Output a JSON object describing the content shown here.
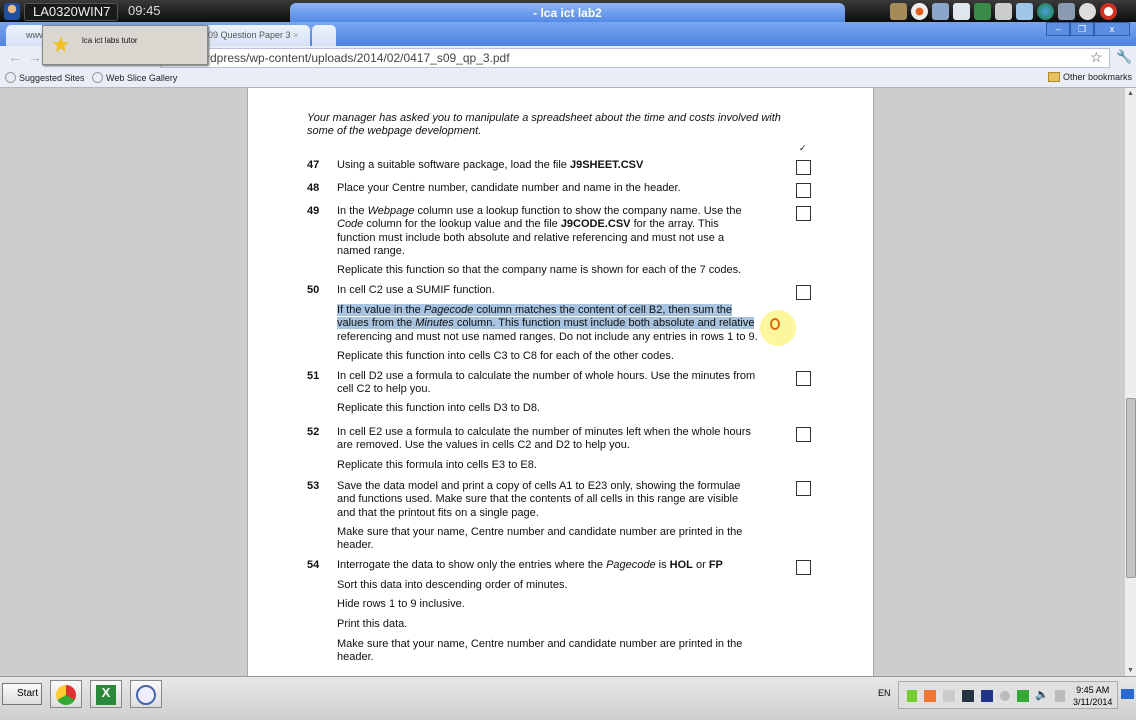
{
  "topbar": {
    "host": "LA0320WIN7",
    "clock": "09:45",
    "window_title": "- lca ict lab2"
  },
  "tabs": [
    {
      "label": "www"
    },
    {
      "label": "09 Question Paper 3"
    }
  ],
  "tooltip": {
    "label": "lca ict labs tutor"
  },
  "window_controls": {
    "minimize": "–",
    "restore": "❐",
    "close": "x"
  },
  "address": {
    "url": "rdpress/wp-content/uploads/2014/02/0417_s09_qp_3.pdf"
  },
  "bookmarks": {
    "items": [
      "Suggested Sites",
      "Web Slice Gallery"
    ],
    "other": "Other bookmarks"
  },
  "doc": {
    "checkmark": "✓",
    "intro": [
      [
        {
          "t": "Your manager has asked you to manipulate a spreadsheet about the time and costs involved with",
          "i": 1
        }
      ],
      [
        {
          "t": "some of the webpage development.",
          "i": 1
        }
      ]
    ],
    "questions": [
      {
        "num": "47",
        "blocks": [
          [
            [
              {
                "t": "Using a suitable software package, load the file "
              },
              {
                "t": "J9SHEET.CSV",
                "b": 1
              }
            ]
          ]
        ]
      },
      {
        "num": "48",
        "blocks": [
          [
            [
              {
                "t": "Place your Centre number, candidate number and name in the header."
              }
            ]
          ]
        ]
      },
      {
        "num": "49",
        "blocks": [
          [
            [
              {
                "t": "In the "
              },
              {
                "t": "Webpage",
                "i": 1
              },
              {
                "t": " column use a lookup function to show the company name. Use the"
              }
            ],
            [
              {
                "t": "Code",
                "i": 1
              },
              {
                "t": " column for the lookup value and the file "
              },
              {
                "t": "J9CODE.CSV",
                "b": 1
              },
              {
                "t": " for the array. This"
              }
            ],
            [
              {
                "t": "function must include both absolute and relative referencing and must not use a"
              }
            ],
            [
              {
                "t": "named range."
              }
            ]
          ],
          [
            [
              {
                "t": "Replicate this function so that the company name is shown for each of the 7 codes."
              }
            ]
          ]
        ]
      },
      {
        "num": "50",
        "blocks": [
          [
            [
              {
                "t": "In cell C2 use a SUMIF function."
              }
            ]
          ],
          [
            [
              {
                "t": "If the value in the ",
                "h": 1
              },
              {
                "t": "Pagecode",
                "i": 1,
                "h": 1
              },
              {
                "t": " column matches the content of cell B2, then sum the",
                "h": 1
              }
            ],
            [
              {
                "t": "values from the ",
                "h": 1
              },
              {
                "t": "Minutes",
                "i": 1,
                "h": 1
              },
              {
                "t": " column. This function must include both absolute and relative",
                "h": 1
              }
            ],
            [
              {
                "t": "referencing and must not use named ranges. Do not include any entries in rows 1 to 9."
              }
            ]
          ],
          [
            [
              {
                "t": "Replicate this function into cells C3 to C8 for each of the other codes."
              }
            ]
          ]
        ]
      },
      {
        "num": "51",
        "blocks": [
          [
            [
              {
                "t": "In cell D2 use a formula to calculate the number of whole hours. Use the minutes from"
              }
            ],
            [
              {
                "t": "cell C2 to help you."
              }
            ]
          ],
          [
            [
              {
                "t": "Replicate this function into cells D3 to D8."
              }
            ]
          ]
        ]
      },
      {
        "num": "52",
        "blocks": [
          [
            [
              {
                "t": "In cell E2 use a formula to calculate the number of minutes left when the whole hours"
              }
            ],
            [
              {
                "t": "are removed. Use the values in cells C2 and D2 to help you."
              }
            ]
          ],
          [
            [
              {
                "t": "Replicate this formula into cells E3 to E8."
              }
            ]
          ]
        ]
      },
      {
        "num": "53",
        "blocks": [
          [
            [
              {
                "t": "Save the data model and print a copy of cells A1 to E23 only, showing the formulae"
              }
            ],
            [
              {
                "t": "and functions used. Make sure that the contents of all cells in this range are visible"
              }
            ],
            [
              {
                "t": "and that the printout fits on a single page."
              }
            ]
          ],
          [
            [
              {
                "t": "Make sure that your name, Centre number and candidate number are printed in the"
              }
            ],
            [
              {
                "t": "header."
              }
            ]
          ]
        ]
      },
      {
        "num": "54",
        "blocks": [
          [
            [
              {
                "t": "Interrogate the data to show only the entries where the "
              },
              {
                "t": "Pagecode",
                "i": 1
              },
              {
                "t": " is "
              },
              {
                "t": "HOL",
                "b": 1
              },
              {
                "t": " or "
              },
              {
                "t": "FP",
                "b": 1
              }
            ]
          ],
          [
            [
              {
                "t": "Sort this data into descending order of minutes."
              }
            ]
          ],
          [
            [
              {
                "t": "Hide rows 1 to 9 inclusive."
              }
            ]
          ],
          [
            [
              {
                "t": "Print this data."
              }
            ]
          ],
          [
            [
              {
                "t": "Make sure that your name, Centre number and candidate number are printed in the"
              }
            ],
            [
              {
                "t": "header."
              }
            ]
          ]
        ]
      }
    ]
  },
  "taskbar": {
    "start": "Start",
    "lang": "EN",
    "time": "9:45 AM",
    "date": "3/11/2014"
  }
}
